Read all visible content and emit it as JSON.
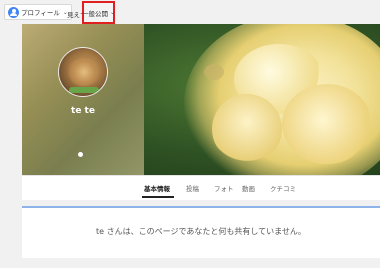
{
  "topbar": {
    "profile_dropdown": {
      "label": "プロフィール",
      "icon": "person-icon",
      "chevron": "⌄"
    },
    "view_as_label": "見えす",
    "privacy_dropdown": {
      "selected": "一般公開",
      "chevron": "⌄",
      "highlight_color": "#e02020"
    }
  },
  "profile": {
    "name": "te te",
    "avatar": "lion-photo"
  },
  "tabs": [
    {
      "label": "基本情報",
      "active": true
    },
    {
      "label": "投稿",
      "active": false
    },
    {
      "label": "フォト",
      "active": false
    },
    {
      "label": "動画",
      "active": false
    },
    {
      "label": "クチコミ",
      "active": false
    }
  ],
  "empty_message": "te さんは、このページであなたと何も共有していません。",
  "colors": {
    "accent": "#8db3e8",
    "brand_blue": "#4285f4"
  }
}
